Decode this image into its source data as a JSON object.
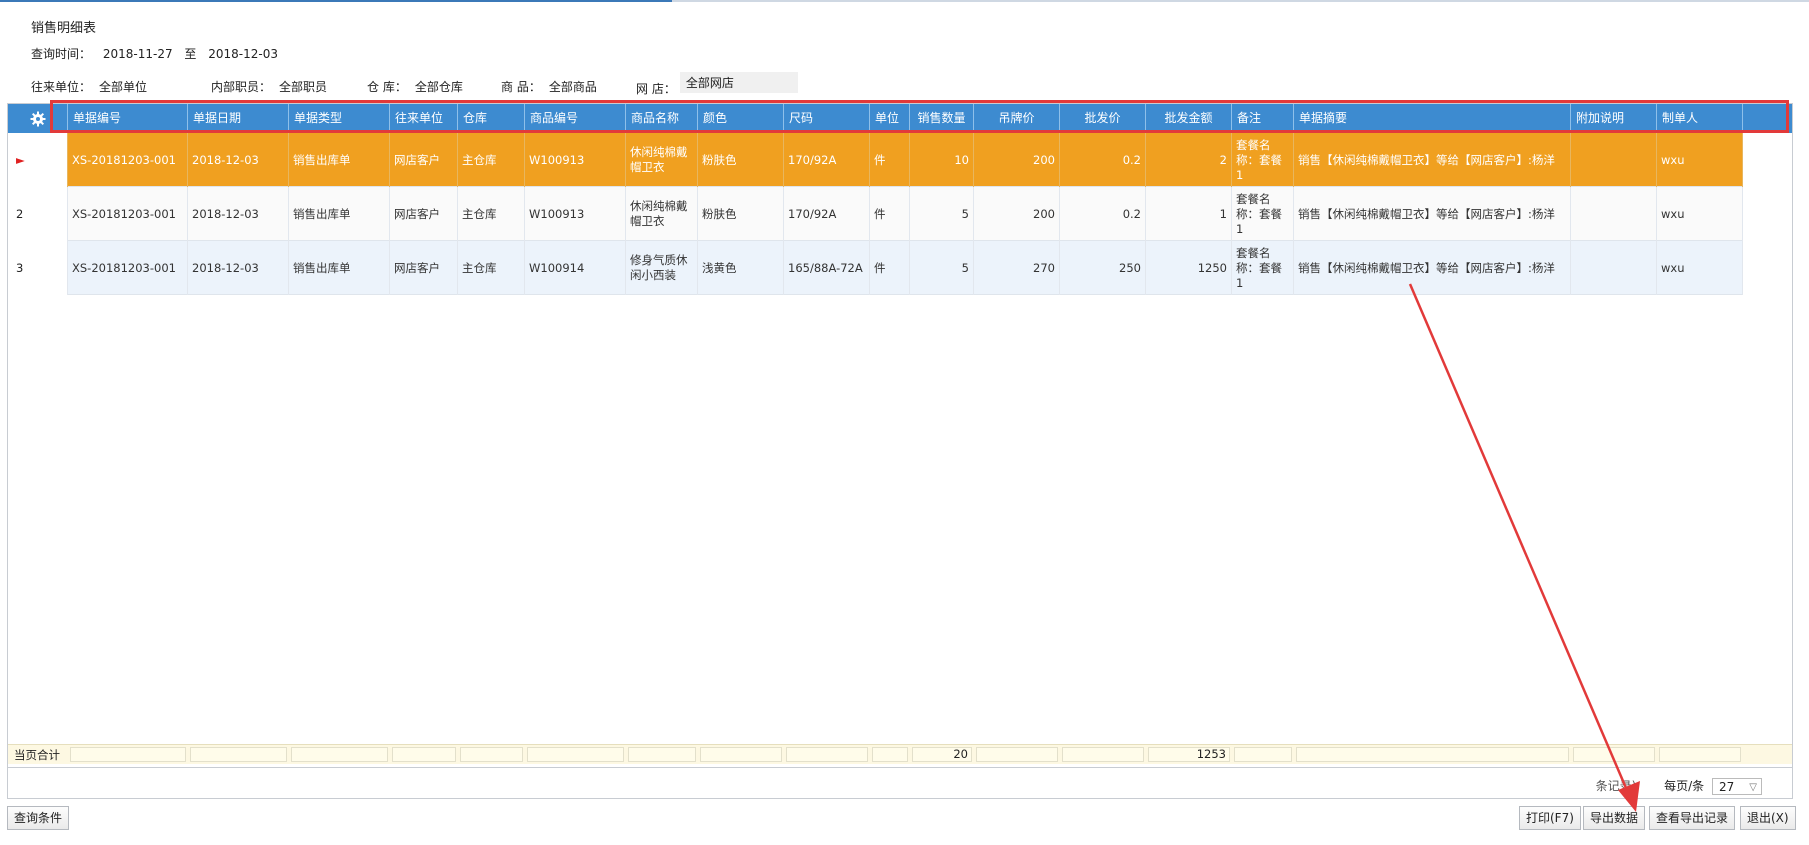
{
  "title": "销售明细表",
  "query_time": {
    "label": "查询时间：",
    "from": "2018-11-27",
    "sep": "至",
    "to": "2018-12-03"
  },
  "filters": [
    {
      "label": "往来单位：",
      "value": "全部单位"
    },
    {
      "label": "内部职员：",
      "value": "全部职员"
    },
    {
      "label": "仓 库：",
      "value": "全部仓库"
    },
    {
      "label": "商 品：",
      "value": "全部商品"
    },
    {
      "label": "网 店：",
      "value": "全部网店"
    }
  ],
  "columns": [
    "单据编号",
    "单据日期",
    "单据类型",
    "往来单位",
    "仓库",
    "商品编号",
    "商品名称",
    "颜色",
    "尺码",
    "单位",
    "销售数量",
    "吊牌价",
    "批发价",
    "批发金额",
    "备注",
    "单据摘要",
    "附加说明",
    "制单人"
  ],
  "rows": [
    {
      "idx": "►",
      "cells": [
        "XS-20181203-001",
        "2018-12-03",
        "销售出库单",
        "网店客户",
        "主仓库",
        "W100913",
        "休闲纯棉戴帽卫衣",
        "粉肤色",
        "170/92A",
        "件",
        "10",
        "200",
        "0.2",
        "2",
        "套餐名称：套餐1",
        "销售【休闲纯棉戴帽卫衣】等给【网店客户】:杨洋",
        "",
        "wxu"
      ]
    },
    {
      "idx": "2",
      "cells": [
        "XS-20181203-001",
        "2018-12-03",
        "销售出库单",
        "网店客户",
        "主仓库",
        "W100913",
        "休闲纯棉戴帽卫衣",
        "粉肤色",
        "170/92A",
        "件",
        "5",
        "200",
        "0.2",
        "1",
        "套餐名称：套餐1",
        "销售【休闲纯棉戴帽卫衣】等给【网店客户】:杨洋",
        "",
        "wxu"
      ]
    },
    {
      "idx": "3",
      "cells": [
        "XS-20181203-001",
        "2018-12-03",
        "销售出库单",
        "网店客户",
        "主仓库",
        "W100914",
        "修身气质休闲小西装",
        "浅黄色",
        "165/88A-72A",
        "件",
        "5",
        "270",
        "250",
        "1250",
        "套餐名称：套餐1",
        "销售【休闲纯棉戴帽卫衣】等给【网店客户】:杨洋",
        "",
        "wxu"
      ]
    }
  ],
  "totals": {
    "label": "当页合计",
    "qty": "20",
    "amount": "1253"
  },
  "pager": {
    "records": "条记录)",
    "per_page_label": "每页/条",
    "per_page": "27"
  },
  "buttons": {
    "query": "查询条件",
    "print": "打印(F7)",
    "export": "导出数据",
    "view_export": "查看导出记录",
    "exit": "退出(X)"
  },
  "colors": {
    "header": "#3d8bd0",
    "selected_row": "#f0a020",
    "annotation": "#e23a3a"
  }
}
